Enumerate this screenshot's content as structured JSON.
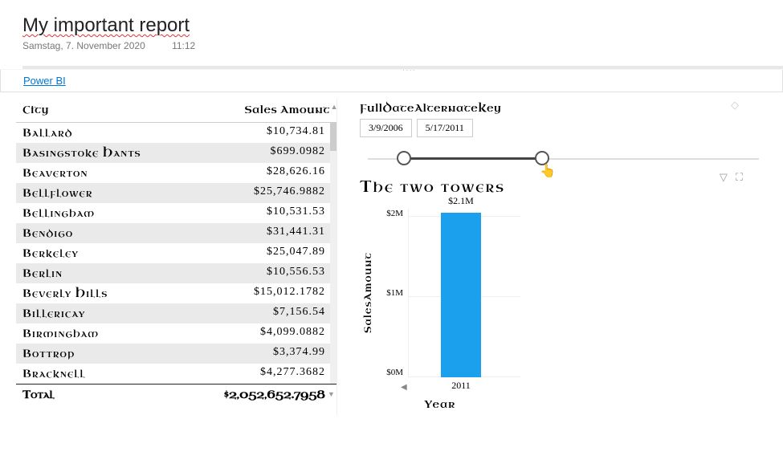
{
  "report": {
    "title": "My important report",
    "date": "Samstag, 7. November 2020",
    "time": "11:12"
  },
  "link": {
    "label": "Power BI"
  },
  "table": {
    "headers": {
      "city": "City",
      "amount": "Sales Amount"
    },
    "rows": [
      {
        "city": "Ballard",
        "amount": "$10,734.81"
      },
      {
        "city": "Basingstoke Hants",
        "amount": "$699.0982"
      },
      {
        "city": "Beaverton",
        "amount": "$28,626.16"
      },
      {
        "city": "Bellflower",
        "amount": "$25,746.9882"
      },
      {
        "city": "Bellingham",
        "amount": "$10,531.53"
      },
      {
        "city": "Bendigo",
        "amount": "$31,441.31"
      },
      {
        "city": "Berkeley",
        "amount": "$25,047.89"
      },
      {
        "city": "Berlin",
        "amount": "$10,556.53"
      },
      {
        "city": "Beverly Hills",
        "amount": "$15,012.1782"
      },
      {
        "city": "Billericay",
        "amount": "$7,156.54"
      },
      {
        "city": "Birmingham",
        "amount": "$4,099.0882"
      },
      {
        "city": "Bottrop",
        "amount": "$3,374.99"
      },
      {
        "city": "Bracknell",
        "amount": "$4,277.3682"
      }
    ],
    "total": {
      "label": "Total",
      "amount": "$2,052,652.7958"
    }
  },
  "slicer": {
    "title": "FullDateAlternateKey",
    "start": "3/9/2006",
    "end": "5/17/2011"
  },
  "chart_data": {
    "type": "bar",
    "title": "The two towers",
    "categories": [
      "2011"
    ],
    "values": [
      2100000
    ],
    "value_labels": [
      "$2.1M"
    ],
    "xlabel": "Year",
    "ylabel": "SalesAmount",
    "yticks": [
      "$2M",
      "$1M",
      "$0M"
    ],
    "ylim": [
      0,
      2100000
    ]
  }
}
